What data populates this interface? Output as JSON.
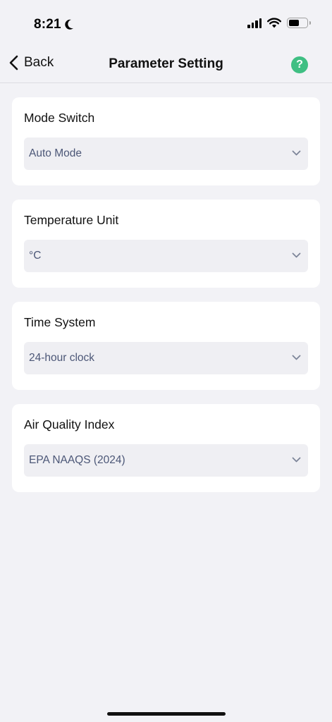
{
  "status_bar": {
    "time": "8:21",
    "icons": [
      "moon-icon",
      "signal-icon",
      "wifi-icon",
      "battery-icon"
    ]
  },
  "nav": {
    "back_label": "Back",
    "title": "Parameter Setting",
    "help_glyph": "?"
  },
  "settings": [
    {
      "label": "Mode Switch",
      "value": "Auto Mode"
    },
    {
      "label": "Temperature Unit",
      "value": "°C"
    },
    {
      "label": "Time System",
      "value": "24-hour clock"
    },
    {
      "label": "Air Quality Index",
      "value": "EPA NAAQS (2024)"
    }
  ],
  "colors": {
    "background": "#f2f2f6",
    "card": "#ffffff",
    "select_bg": "#efeff3",
    "select_text": "#4c5777",
    "help_accent": "#3fbf83"
  }
}
